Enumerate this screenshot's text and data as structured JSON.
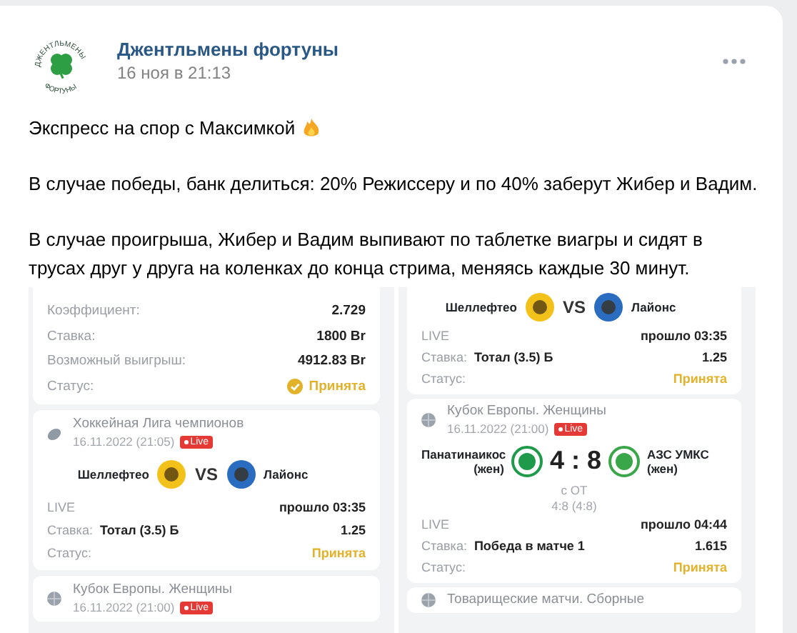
{
  "post": {
    "author": "Джентльмены фортуны",
    "date": "16 ноя в 21:13",
    "logo_text_top": "ДЖЕНТЛЬМЕНЫ",
    "logo_text_bottom": "ФОРТУНЫ"
  },
  "paragraphs": [
    {
      "text": "Экспресс на спор с Максимкой"
    },
    {
      "text": "В случае победы, банк делиться: 20% Режиссеру и по 40% заберут Жибер и Вадим."
    },
    {
      "text": "В случае проигрыша, Жибер и Вадим выпивают по таблетке виагры и сидят в трусах друг у друга на коленках до конца стрима, меняясь каждые 30 минут."
    }
  ],
  "screenshots": [
    {
      "blocks": [
        {
          "kind": "summary",
          "rows": [
            {
              "label": "Коэффициент:",
              "value": "2.729"
            },
            {
              "label": "Ставка:",
              "value": "1800 Br"
            },
            {
              "label": "Возможный выигрыш:",
              "value": "4912.83 Br"
            }
          ],
          "status_label": "Статус:",
          "status": "Принята"
        },
        {
          "kind": "hockey",
          "league": "Хоккейная Лига чемпионов",
          "date": "16.11.2022 (21:05)",
          "badge": "Live",
          "home": "Шеллефтео",
          "away": "Лайонс",
          "center": "VS",
          "state": "LIVE",
          "elapsed": "прошло 03:35",
          "bet_label": "Ставка:",
          "bet": "Тотал (3.5) Б",
          "odds": "1.25",
          "status_label": "Статус:",
          "status": "Принята"
        },
        {
          "kind": "football",
          "league": "Кубок Европы. Женщины",
          "date": "16.11.2022 (21:00)",
          "badge": "Live"
        }
      ]
    },
    {
      "blocks": [
        {
          "kind": "hockey",
          "home": "Шеллефтео",
          "away": "Лайонс",
          "center": "VS",
          "state": "LIVE",
          "elapsed": "прошло 03:35",
          "bet_label": "Ставка:",
          "bet": "Тотал (3.5) Б",
          "odds": "1.25",
          "status_label": "Статус:",
          "status": "Принята"
        },
        {
          "kind": "football",
          "league": "Кубок Европы. Женщины",
          "date": "16.11.2022 (21:00)",
          "badge": "Live",
          "home": "Панатинаикос (жен)",
          "away": "АЗС УМКС (жен)",
          "center": "4 : 8",
          "notes": [
            "с ОТ",
            "4:8 (4:8)"
          ],
          "state": "LIVE",
          "elapsed": "прошло 04:44",
          "bet_label": "Ставка:",
          "bet": "Победа в матче 1",
          "odds": "1.615",
          "status_label": "Статус:",
          "status": "Принята"
        },
        {
          "kind": "football",
          "league": "Товарищеские матчи. Сборные"
        }
      ]
    }
  ]
}
